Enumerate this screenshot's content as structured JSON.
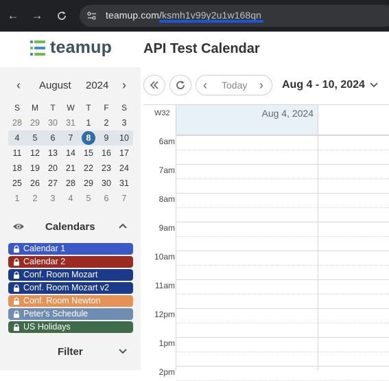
{
  "browser": {
    "url_domain": "teamup.com/",
    "url_path": "ksmh1v99y2u1w168qn"
  },
  "app": {
    "brand": "teamup",
    "calendar_title": "API Test Calendar"
  },
  "mini_calendar": {
    "month": "August",
    "year": "2024",
    "weekdays": [
      "S",
      "M",
      "T",
      "W",
      "T",
      "F",
      "S"
    ],
    "weeks": [
      [
        "28",
        "29",
        "30",
        "31",
        "1",
        "2",
        "3"
      ],
      [
        "4",
        "5",
        "6",
        "7",
        "8",
        "9",
        "10"
      ],
      [
        "11",
        "12",
        "13",
        "14",
        "15",
        "16",
        "17"
      ],
      [
        "18",
        "19",
        "20",
        "21",
        "22",
        "23",
        "24"
      ],
      [
        "25",
        "26",
        "27",
        "28",
        "29",
        "30",
        "31"
      ],
      [
        "1",
        "2",
        "3",
        "4",
        "5",
        "6",
        "7"
      ]
    ],
    "today": "8"
  },
  "calendars_section": {
    "title": "Calendars",
    "items": [
      {
        "label": "Calendar 1",
        "color": "#3b58c7"
      },
      {
        "label": "Calendar 2",
        "color": "#9b2a20"
      },
      {
        "label": "Conf. Room Mozart",
        "color": "#1c3a8a"
      },
      {
        "label": "Conf. Room Mozart v2",
        "color": "#1c3a8a"
      },
      {
        "label": "Conf. Room Newton",
        "color": "#e59256"
      },
      {
        "label": "Peter's Schedule",
        "color": "#6f8db2"
      },
      {
        "label": "US Holidays",
        "color": "#3f6b4a"
      }
    ]
  },
  "filter_section": {
    "title": "Filter"
  },
  "toolbar": {
    "today_label": "Today",
    "range_label": "Aug 4 - 10, 2024"
  },
  "grid": {
    "week_label": "W32",
    "day_label": "Aug 4, 2024",
    "hours": [
      "6am",
      "7am",
      "8am",
      "9am",
      "10am",
      "11am",
      "12pm",
      "1pm",
      "2pm"
    ]
  }
}
